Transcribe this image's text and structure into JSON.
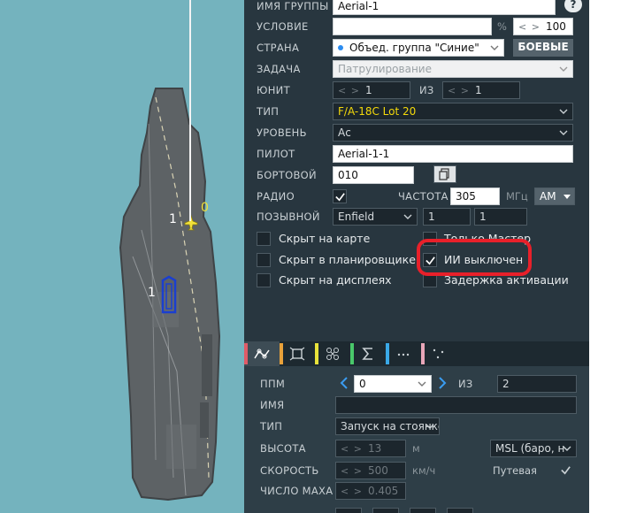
{
  "map": {
    "labels": {
      "unit_count_top": "1",
      "waypoint_index": "0",
      "unit_count_lower": "1"
    }
  },
  "panel": {
    "group_name": {
      "label": "ИМЯ ГРУППЫ",
      "value": "Aerial-1"
    },
    "help": "?",
    "condition": {
      "label": "УСЛОВИЕ",
      "value": "",
      "unit": "%",
      "percent": "100"
    },
    "country": {
      "label": "СТРАНА",
      "value": "Объед. группа \"Синие\"",
      "button": "БОЕВЫЕ"
    },
    "task": {
      "label": "ЗАДАЧА",
      "value": "Патрулирование"
    },
    "unit": {
      "label": "ЮНИТ",
      "value": "1",
      "of_label": "ИЗ",
      "of_value": "1"
    },
    "type": {
      "label": "ТИП",
      "value": "F/A-18C Lot 20"
    },
    "skill": {
      "label": "УРОВЕНЬ",
      "value": "Ас"
    },
    "pilot": {
      "label": "ПИЛОТ",
      "value": "Aerial-1-1"
    },
    "tail": {
      "label": "БОРТОВОЙ",
      "value": "010"
    },
    "radio": {
      "label": "РАДИО",
      "checked": true,
      "freq_label": "ЧАСТОТА",
      "freq_value": "305",
      "freq_unit": "МГц",
      "modulation": "AM"
    },
    "callsign": {
      "label": "ПОЗЫВНОЙ",
      "value": "Enfield",
      "num1": "1",
      "num2": "1"
    },
    "checkboxes": {
      "hidden_map": {
        "label": "Скрыт на карте",
        "checked": false
      },
      "hidden_planner": {
        "label": "Скрыт в планировщике",
        "checked": false
      },
      "hidden_display": {
        "label": "Скрыт на дисплеях",
        "checked": false
      },
      "master_only": {
        "label": "Только Мастер",
        "checked": false
      },
      "ai_off": {
        "label": "ИИ выключен",
        "checked": true
      },
      "late_activation": {
        "label": "Задержка активации",
        "checked": false
      }
    },
    "tabs": [
      {
        "name": "route",
        "color": "#e05a66"
      },
      {
        "name": "targets",
        "color": "#e8a13a"
      },
      {
        "name": "triggers",
        "color": "#e8e23a"
      },
      {
        "name": "summary",
        "color": "#49c86a"
      },
      {
        "name": "payload",
        "color": "#3aa9e8"
      },
      {
        "name": "fuel",
        "color": "#e8a6b8"
      }
    ],
    "waypoint": {
      "label": "ППМ",
      "value": "0",
      "of_label": "ИЗ",
      "of_value": "2"
    },
    "wp_name": {
      "label": "ИМЯ",
      "value": ""
    },
    "wp_type": {
      "label": "ТИП",
      "value": "Запуск на стоянке"
    },
    "altitude": {
      "label": "ВЫСОТА",
      "value": "13",
      "unit": "м",
      "ref": "MSL (баро, н"
    },
    "speed": {
      "label": "СКОРОСТЬ",
      "value": "500",
      "unit": "км/ч",
      "route_label": "Путевая",
      "route_checked": true
    },
    "mach": {
      "label": "ЧИСЛО МАХА",
      "value": "0.405"
    }
  },
  "colors": {
    "panel_bg": "#28363f",
    "highlight": "#e8202a",
    "type_text": "#f4d90a"
  }
}
